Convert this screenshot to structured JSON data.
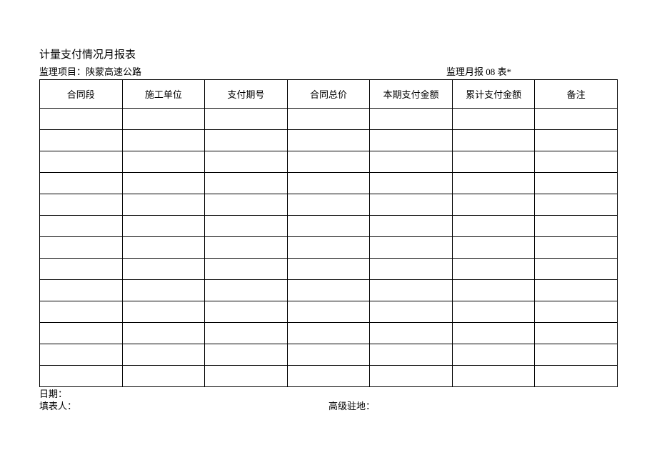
{
  "title": "计量支付情况月报表",
  "meta": {
    "project_label": "监理项目：",
    "project_value": "陕蒙高速公路",
    "report_label": "监理月报 08 表*"
  },
  "table": {
    "headers": [
      "合同段",
      "施工单位",
      "支付期号",
      "合同总价",
      "本期支付金额",
      "累计支付金额",
      "备注"
    ],
    "row_count": 13
  },
  "footer": {
    "date_label": "日期：",
    "preparer_label": "填表人：",
    "resident_label": "高级驻地："
  }
}
